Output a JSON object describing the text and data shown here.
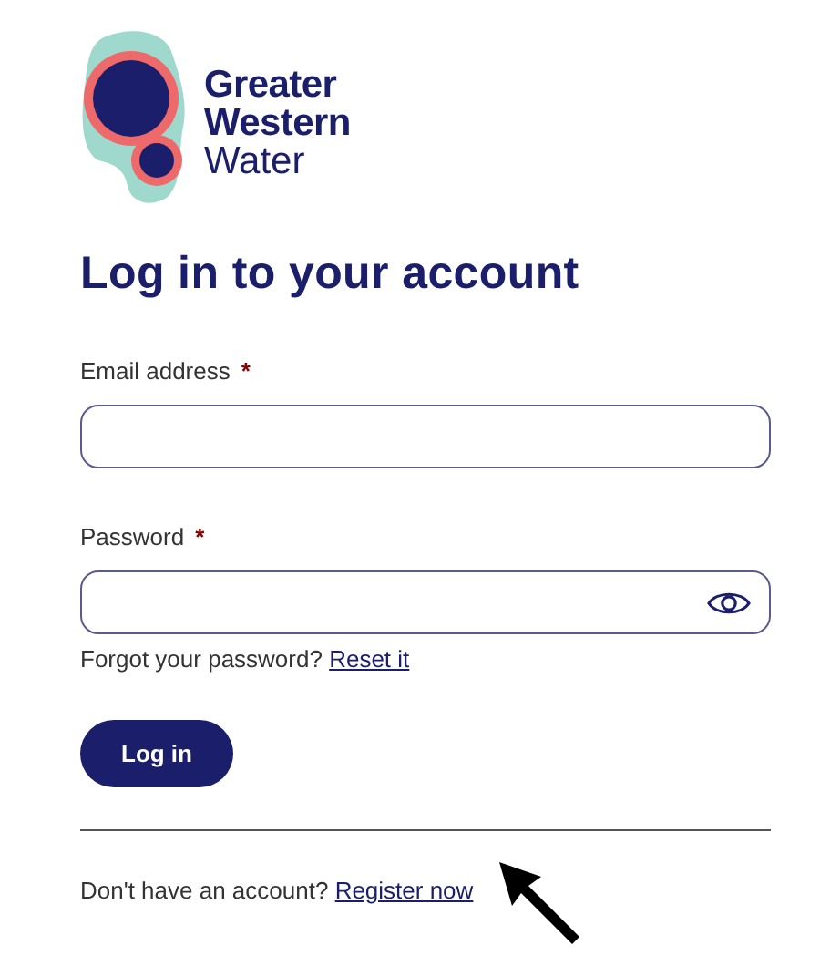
{
  "logo": {
    "lines": [
      {
        "text": "Greater",
        "kind": "bold"
      },
      {
        "text": "Western",
        "kind": "bold"
      },
      {
        "text": "Water",
        "kind": "light"
      }
    ]
  },
  "heading": "Log in to your account",
  "fields": [
    {
      "label": "Email address",
      "required": true,
      "required_mark": "*",
      "kind": "text"
    },
    {
      "label": "Password",
      "required": true,
      "required_mark": "*",
      "kind": "password"
    }
  ],
  "forgot": {
    "text": "Forgot your password?",
    "link": "Reset it"
  },
  "login_button": "Log in",
  "register": {
    "text": "Don't have an account?",
    "link": "Register now"
  }
}
